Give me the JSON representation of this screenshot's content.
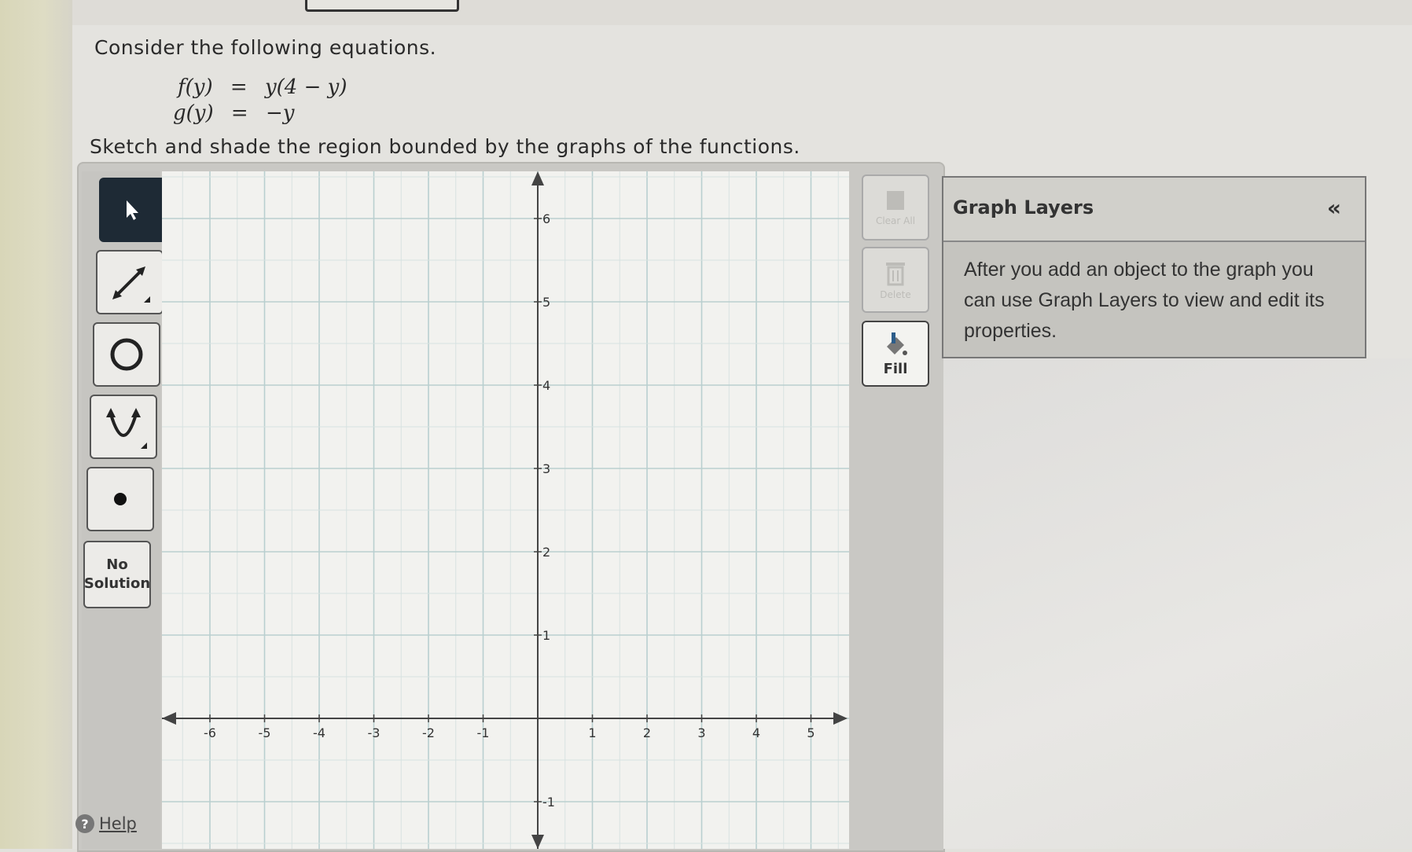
{
  "problem": {
    "prompt": "Consider the following equations.",
    "eq_f_lhs": "f(y)",
    "eq_f_rhs": "y(4 − y)",
    "eq_g_lhs": "g(y)",
    "eq_g_rhs": "−y",
    "equals": "=",
    "instruction": "Sketch and shade the region bounded by the graphs of the functions."
  },
  "toolbar": {
    "tools": [
      {
        "name": "pointer-tool",
        "icon": "pointer-arrow-icon",
        "active": true
      },
      {
        "name": "line-tool",
        "icon": "line-ray-icon"
      },
      {
        "name": "circle-tool",
        "icon": "circle-icon"
      },
      {
        "name": "parabola-tool",
        "icon": "parabola-icon"
      },
      {
        "name": "point-tool",
        "icon": "point-icon"
      }
    ],
    "no_solution_label": "No Solution",
    "help_label": "Help"
  },
  "graph": {
    "x_range": [
      -6,
      5
    ],
    "y_range": [
      -1,
      6
    ],
    "x_ticks": [
      "-6",
      "-5",
      "-4",
      "-3",
      "-2",
      "-1",
      "1",
      "2",
      "3",
      "4",
      "5"
    ],
    "y_ticks": [
      "6",
      "5",
      "4",
      "3",
      "2",
      "1",
      "-1"
    ],
    "grid": true
  },
  "side_buttons": {
    "clear_all_label": "Clear All",
    "delete_label": "Delete",
    "fill_label": "Fill"
  },
  "graph_layers": {
    "title": "Graph Layers",
    "collapse_icon": "«",
    "body": "After you add an object to the graph you can use Graph Layers to view and edit its properties."
  }
}
